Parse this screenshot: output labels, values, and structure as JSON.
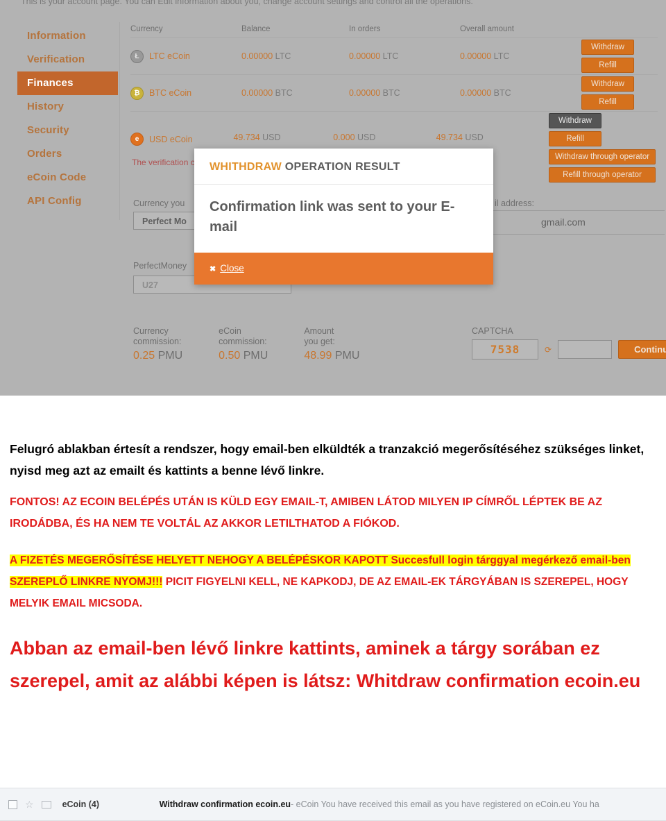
{
  "screenshot": {
    "header_note": "This is your account page. You can Edit information about you, change account settings and control all the operations.",
    "sidebar": {
      "items": [
        {
          "label": "Information",
          "active": false
        },
        {
          "label": "Verification",
          "active": false
        },
        {
          "label": "Finances",
          "active": true
        },
        {
          "label": "History",
          "active": false
        },
        {
          "label": "Security",
          "active": false
        },
        {
          "label": "Orders",
          "active": false
        },
        {
          "label": "eCoin Code",
          "active": false
        },
        {
          "label": "API Config",
          "active": false
        }
      ]
    },
    "balances_table": {
      "headers": {
        "currency": "Currency",
        "balance": "Balance",
        "in_orders": "In orders",
        "overall": "Overall amount"
      },
      "rows": [
        {
          "icon": "ltc-coin-icon",
          "name": "LTC eCoin",
          "balance_value": "0.00000",
          "balance_unit": "LTC",
          "orders_value": "0.00000",
          "orders_unit": "LTC",
          "overall_value": "0.00000",
          "overall_unit": "LTC",
          "withdraw": "Withdraw",
          "refill": "Refill"
        },
        {
          "icon": "btc-coin-icon",
          "name": "BTC eCoin",
          "balance_value": "0.00000",
          "balance_unit": "BTC",
          "orders_value": "0.00000",
          "orders_unit": "BTC",
          "overall_value": "0.00000",
          "overall_unit": "BTC",
          "withdraw": "Withdraw",
          "refill": "Refill"
        },
        {
          "icon": "usd-coin-icon",
          "name": "USD eCoin",
          "balance_value": "49.734",
          "balance_unit": "USD",
          "orders_value": "0.000",
          "orders_unit": "USD",
          "overall_value": "49.734",
          "overall_unit": "USD",
          "withdraw": "Withdraw",
          "refill": "Refill",
          "withdraw_operator": "Withdraw through operator",
          "refill_operator": "Refill through operator"
        }
      ]
    },
    "verification_note": "The verification c",
    "form": {
      "currency_label": "Currency you",
      "currency_value": "Perfect Mo",
      "perfectmoney_label": "PerfectMoney",
      "perfectmoney_value": "U27",
      "email_label": "il address:",
      "email_value": "gmail.com"
    },
    "commission": [
      {
        "label_line1": "Currency",
        "label_line2": "commission:",
        "value": "0.25",
        "unit": "PMU"
      },
      {
        "label_line1": "eCoin",
        "label_line2": "commission:",
        "value": "0.50",
        "unit": "PMU"
      },
      {
        "label_line1": "Amount",
        "label_line2": "you get:",
        "value": "48.99",
        "unit": "PMU"
      }
    ],
    "captcha": {
      "label": "CAPTCHA",
      "code": "7538",
      "refresh_icon": "refresh-icon",
      "input_value": "",
      "continue_label": "Continue"
    },
    "modal": {
      "title_highlight": "WHITHDRAW",
      "title_rest": " OPERATION RESULT",
      "message": "Confirmation link was sent to your E-mail",
      "close_label": "Close",
      "close_icon": "close-icon"
    },
    "colors": {
      "accent_orange": "#d5711d",
      "modal_footer_orange": "#e8772e",
      "sidebar_active": "#c2662c",
      "page_grey": "#b3b3b3"
    }
  },
  "document": {
    "paragraph_black": "Felugró ablakban értesít a rendszer, hogy email-ben elküldték a tranzakció megerősítéséhez szükséges linket, nyisd meg azt az emailt és kattints a benne lévő linkre.",
    "paragraph_red_caps": "FONTOS! AZ ECOIN BELÉPÉS UTÁN IS KÜLD EGY EMAIL-T, AMIBEN LÁTOD MILYEN IP CÍMRŐL LÉPTEK BE AZ IRODÁDBA, ÉS HA NEM TE VOLTÁL AZ AKKOR LETILTHATOD A FIÓKOD.",
    "paragraph_highlight_part": "A FIZETÉS MEGERŐSÍTÉSE HELYETT NEHOGY A BELÉPÉSKOR KAPOTT Succesfull login tárggyal megérkező email-ben SZEREPLŐ LINKRE NYOMJ!!!",
    "paragraph_highlight_rest": " PICIT FIGYELNI KELL, NE KAPKODJ, DE AZ EMAIL-EK TÁRGYÁBAN IS SZEREPEL, HOGY MELYIK EMAIL MICSODA.",
    "paragraph_big_red": "Abban az email-ben lévő linkre kattints, aminek a tárgy sorában ez szerepel, amit az alábbi képen is látsz:  Whitdraw confirmation ecoin.eu",
    "colors": {
      "red": "#e01b1b",
      "highlight_yellow": "#ffff00"
    }
  },
  "mail_row": {
    "checkbox_icon": "checkbox-icon",
    "star_icon": "star-icon",
    "tag_icon": "label-tag-icon",
    "sender": "eCoin (4)",
    "subject": "Withdraw confirmation ecoin.eu",
    "snippet": " - eCoin You have received this email as you have registered on eCoin.eu You ha"
  }
}
